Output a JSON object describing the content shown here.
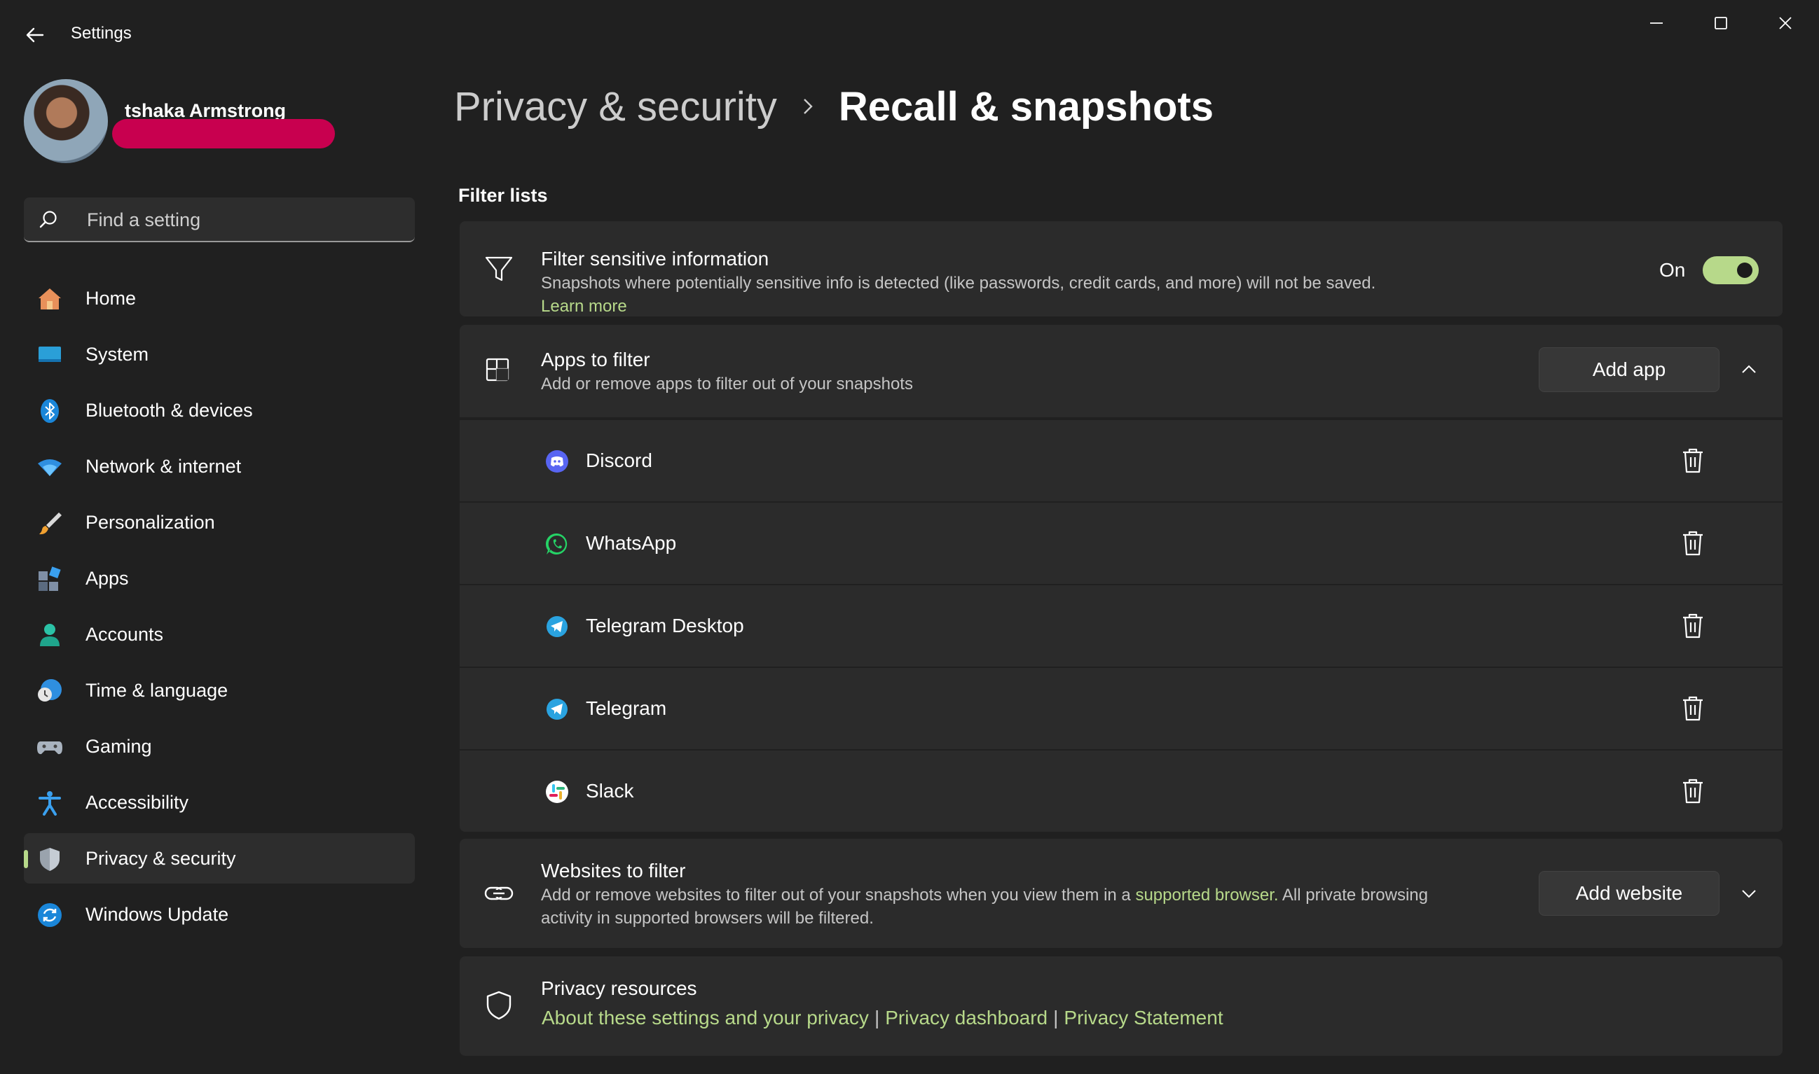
{
  "window": {
    "title": "Settings",
    "controls": [
      "minimize",
      "maximize",
      "close"
    ]
  },
  "profile": {
    "name": "tshaka Armstrong"
  },
  "search": {
    "placeholder": "Find a setting"
  },
  "sidebar": {
    "items": [
      {
        "label": "Home",
        "icon": "home-icon",
        "active": false
      },
      {
        "label": "System",
        "icon": "system-icon",
        "active": false
      },
      {
        "label": "Bluetooth & devices",
        "icon": "bluetooth-icon",
        "active": false
      },
      {
        "label": "Network & internet",
        "icon": "wifi-icon",
        "active": false
      },
      {
        "label": "Personalization",
        "icon": "brush-icon",
        "active": false
      },
      {
        "label": "Apps",
        "icon": "apps-icon",
        "active": false
      },
      {
        "label": "Accounts",
        "icon": "accounts-icon",
        "active": false
      },
      {
        "label": "Time & language",
        "icon": "time-language-icon",
        "active": false
      },
      {
        "label": "Gaming",
        "icon": "gamepad-icon",
        "active": false
      },
      {
        "label": "Accessibility",
        "icon": "accessibility-icon",
        "active": false
      },
      {
        "label": "Privacy & security",
        "icon": "shield-icon",
        "active": true
      },
      {
        "label": "Windows Update",
        "icon": "update-icon",
        "active": false
      }
    ]
  },
  "breadcrumb": {
    "parent": "Privacy & security",
    "current": "Recall & snapshots"
  },
  "main": {
    "section_title": "Filter lists",
    "filter_sensitive": {
      "title": "Filter sensitive information",
      "description": "Snapshots where potentially sensitive info is detected (like passwords, credit cards, and more) will not be saved.",
      "link": "Learn more",
      "toggle_label": "On",
      "toggle_on": true
    },
    "apps_to_filter": {
      "title": "Apps to filter",
      "description": "Add or remove apps to filter out of your snapshots",
      "button": "Add app",
      "expanded": true,
      "apps": [
        {
          "name": "Discord",
          "icon": "discord-icon"
        },
        {
          "name": "WhatsApp",
          "icon": "whatsapp-icon"
        },
        {
          "name": "Telegram Desktop",
          "icon": "telegram-icon"
        },
        {
          "name": "Telegram",
          "icon": "telegram-icon"
        },
        {
          "name": "Slack",
          "icon": "slack-icon"
        }
      ]
    },
    "websites_to_filter": {
      "title": "Websites to filter",
      "description_before": "Add or remove websites to filter out of your snapshots when you view them in a",
      "link": "supported browser.",
      "description_after": "All private browsing activity in supported browsers will be filtered.",
      "button": "Add website",
      "expanded": false
    },
    "privacy_resources": {
      "title": "Privacy resources",
      "links": [
        "About these settings and your privacy",
        "Privacy dashboard",
        "Privacy Statement"
      ]
    }
  },
  "colors": {
    "background": "#202020",
    "card": "#2b2b2b",
    "accent": "#b7d98a",
    "redaction": "#c8004f"
  }
}
